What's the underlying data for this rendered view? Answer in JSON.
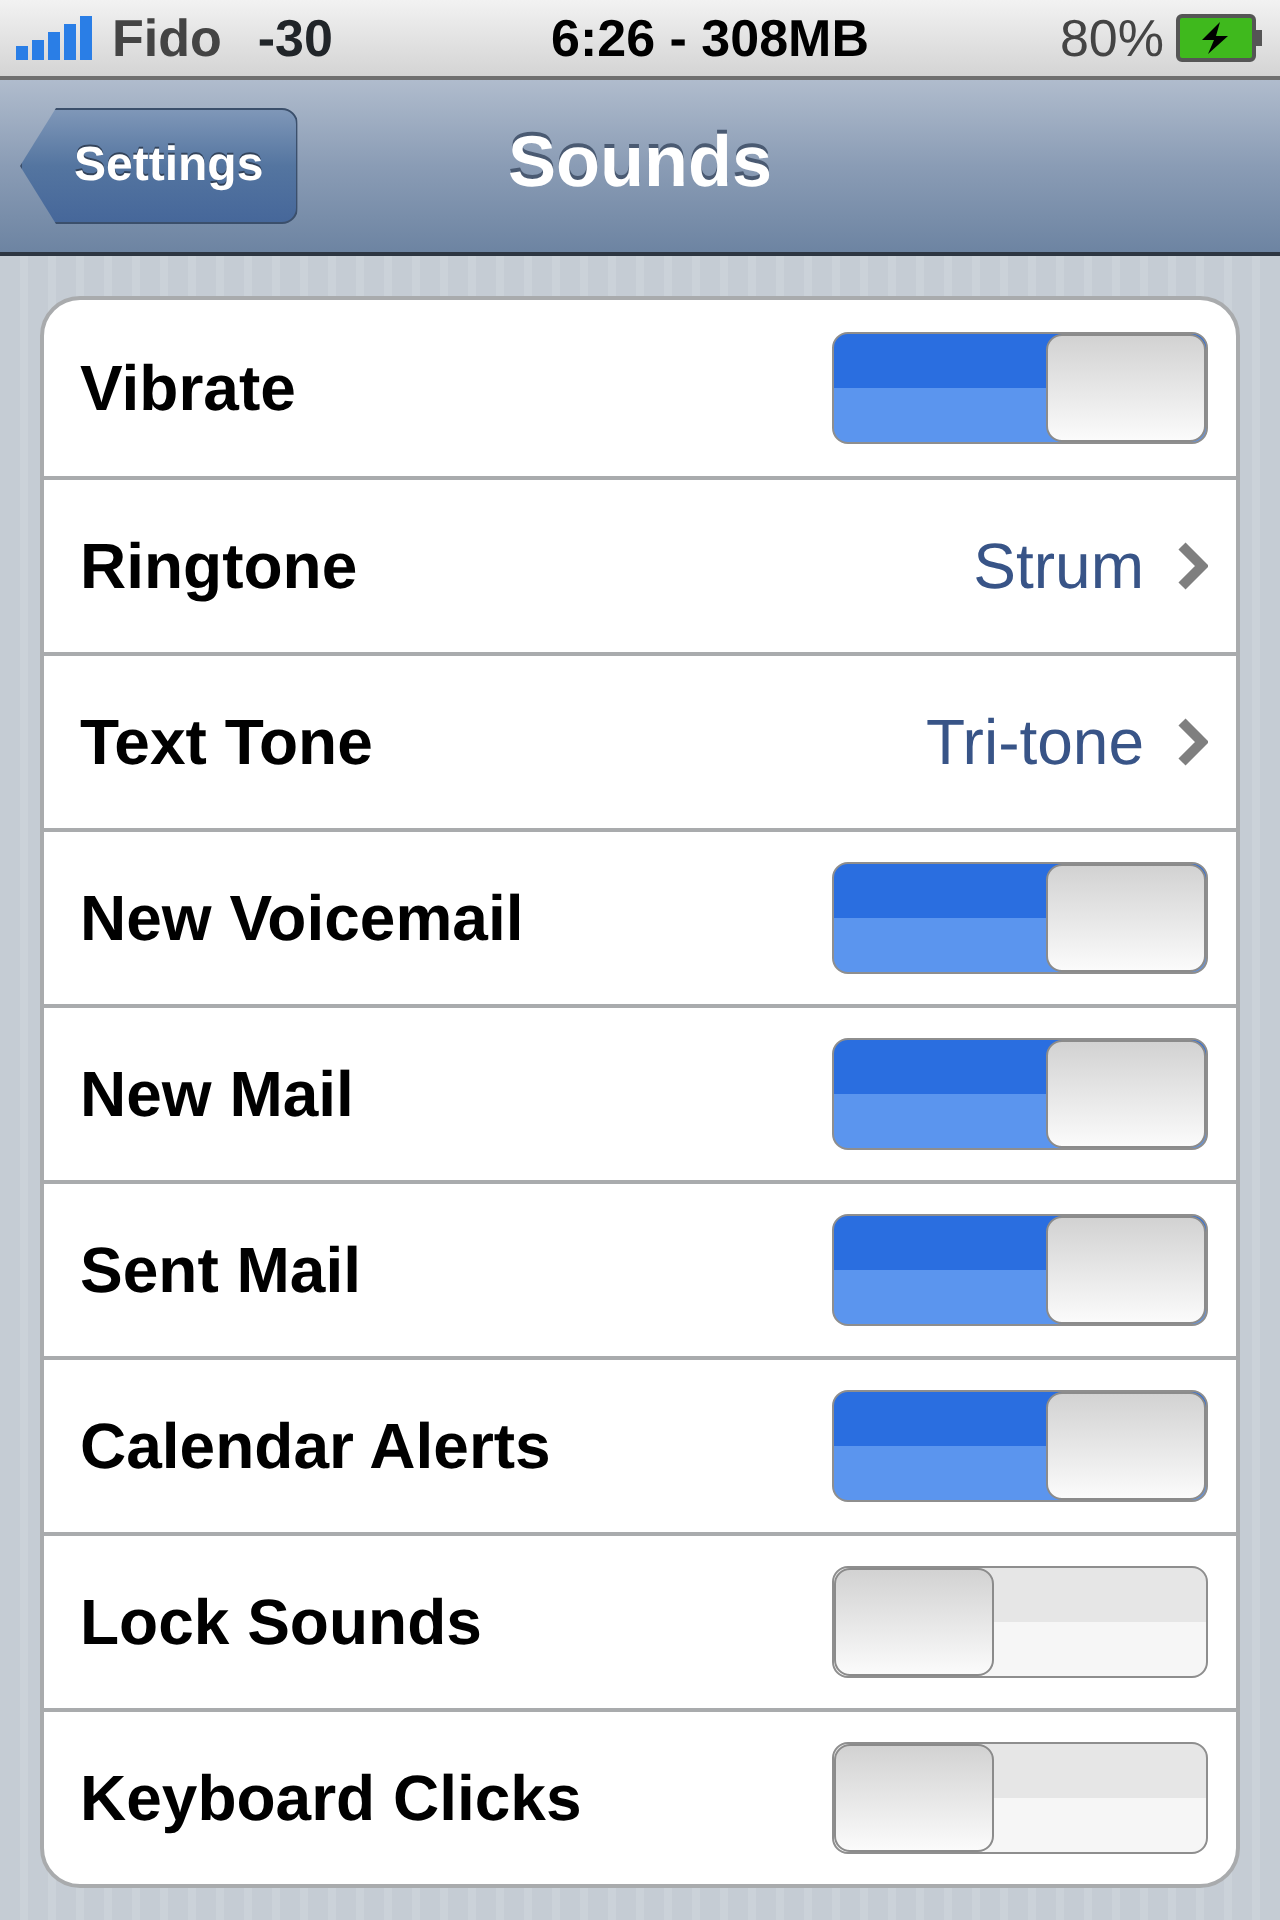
{
  "status_bar": {
    "carrier": "Fido",
    "signal_reading": "-30",
    "center": "6:26 - 308MB",
    "battery": "80%"
  },
  "nav_bar": {
    "back": "Settings",
    "title": "Sounds"
  },
  "rows": [
    {
      "kind": "switch",
      "label": "Vibrate",
      "on": true
    },
    {
      "kind": "detail",
      "label": "Ringtone",
      "value": "Strum"
    },
    {
      "kind": "detail",
      "label": "Text Tone",
      "value": "Tri-tone"
    },
    {
      "kind": "switch",
      "label": "New Voicemail",
      "on": true
    },
    {
      "kind": "switch",
      "label": "New Mail",
      "on": true
    },
    {
      "kind": "switch",
      "label": "Sent Mail",
      "on": true
    },
    {
      "kind": "switch",
      "label": "Calendar Alerts",
      "on": true
    },
    {
      "kind": "switch",
      "label": "Lock Sounds",
      "on": false
    },
    {
      "kind": "switch",
      "label": "Keyboard Clicks",
      "on": false
    }
  ]
}
